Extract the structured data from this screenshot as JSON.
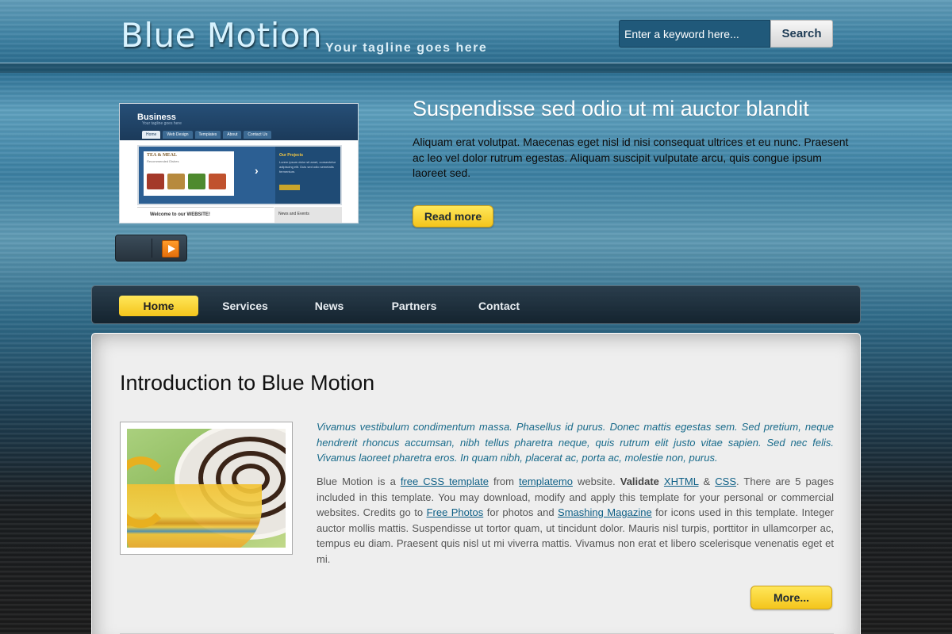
{
  "header": {
    "site_title": "Blue Motion",
    "tagline": "Your tagline goes here",
    "search_placeholder": "Enter a keyword here...",
    "search_button": "Search"
  },
  "slider": {
    "thumbnail": {
      "brand": "Business",
      "brand_tagline": "Your tagline goes here",
      "nav": [
        "Home",
        "Web Design",
        "Templates",
        "About",
        "Contact Us"
      ],
      "card_title": "TEA & MEAL",
      "card_sub": "Recommended Dishes",
      "side_heading": "Our Projects",
      "side_text": "Lorem ipsum dolor sit amet, consectetur adipiscing elit. Duis sed odio semetatis fermentum.",
      "side_button": "Read more",
      "welcome": "Welcome to our WEBSITE!",
      "news": "News and Events"
    },
    "title": "Suspendisse sed odio ut mi auctor blandit",
    "text": "Aliquam erat volutpat. Maecenas eget nisl id nisi consequat ultrices et eu nunc. Praesent ac leo vel dolor rutrum egestas. Aliquam suscipit vulputate arcu, quis congue ipsum laoreet sed.",
    "read_more": "Read more"
  },
  "nav": {
    "items": [
      {
        "label": "Home",
        "active": true
      },
      {
        "label": "Services",
        "active": false
      },
      {
        "label": "News",
        "active": false
      },
      {
        "label": "Partners",
        "active": false
      },
      {
        "label": "Contact",
        "active": false
      }
    ]
  },
  "content": {
    "title": "Introduction to Blue Motion",
    "italic_text": "Vivamus vestibulum condimentum massa. Phasellus id purus. Donec mattis egestas sem. Sed pretium, neque hendrerit rhoncus accumsan, nibh tellus pharetra neque, quis rutrum elit justo vitae sapien. Sed nec felis. Vivamus laoreet pharetra eros. In quam nibh, placerat ac, porta ac, molestie non, purus.",
    "body": {
      "t1": "Blue Motion is a ",
      "link_free_css": "free CSS template",
      "t2": " from ",
      "link_templatemo": "templatemo",
      "t3": " website. ",
      "validate": "Validate",
      "t4": " ",
      "link_xhtml": "XHTML",
      "t5": " & ",
      "link_css": "CSS",
      "t6": ". There are 5 pages included in this template. You may download, modify and apply this template for your personal or commercial websites. Credits go to ",
      "link_free_photos": "Free Photos",
      "t7": " for photos and ",
      "link_smashing": "Smashing Magazine",
      "t8": " for icons used in this template. Integer auctor mollis mattis. Suspendisse ut tortor quam, ut tincidunt dolor. Mauris nisl turpis, porttitor in ullamcorper ac, tempus eu diam. Praesent quis nisl ut mi viverra mattis. Vivamus non erat et libero scelerisque venenatis eget et mi."
    },
    "more_button": "More..."
  },
  "colors": {
    "accent_yellow": "#f4c51c",
    "link_blue": "#0d5f86",
    "italic_blue": "#186a8a",
    "play_orange": "#e46f0c"
  }
}
